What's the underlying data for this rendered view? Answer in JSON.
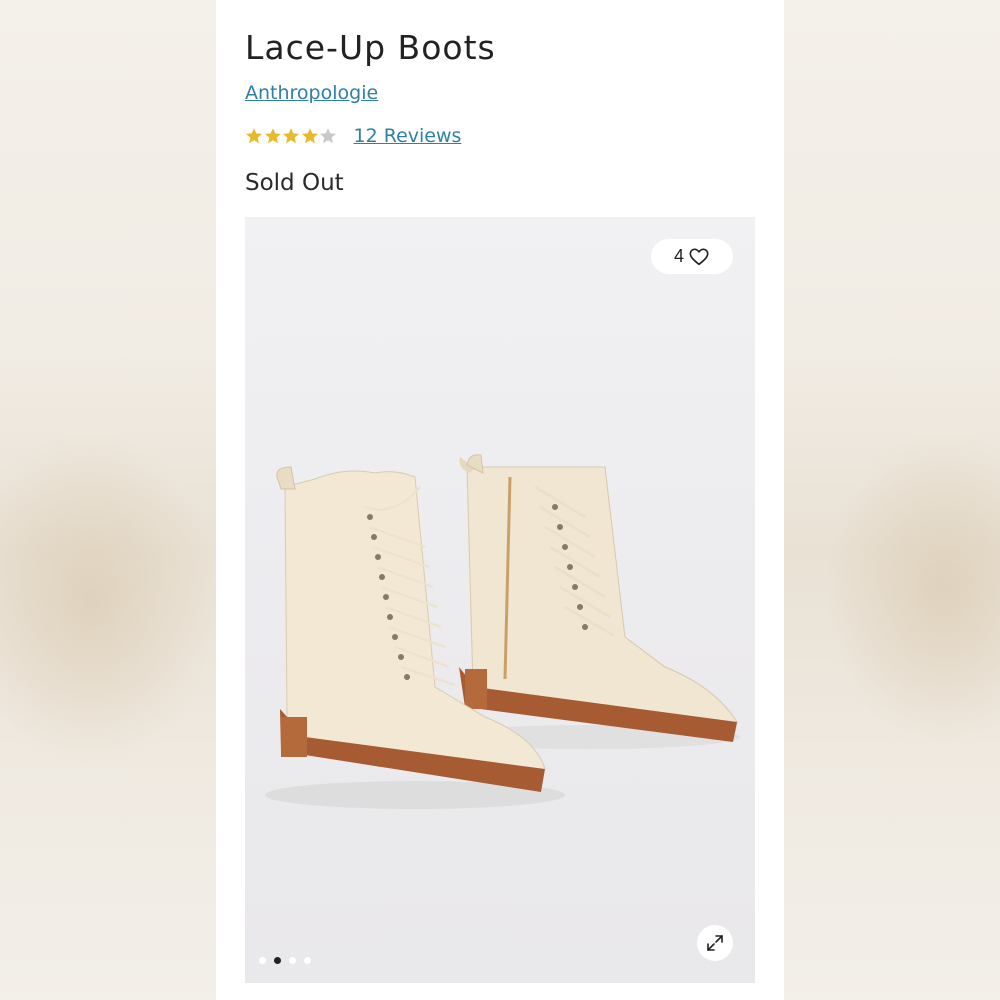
{
  "product": {
    "title": "Lace-Up Boots",
    "brand": "Anthropologie",
    "rating": 4,
    "rating_max": 5,
    "reviews_label": "12 Reviews",
    "status": "Sold Out"
  },
  "gallery": {
    "favorites_count": "4",
    "favorite_icon": "heart-icon",
    "expand_icon": "expand-icon",
    "image_alt": "Cream leather lace-up boots",
    "current_slide": 2,
    "total_slides": 4
  },
  "colors": {
    "star_filled": "#e9b92e",
    "star_empty": "#c9c9c9",
    "link": "#2f7fa8"
  }
}
